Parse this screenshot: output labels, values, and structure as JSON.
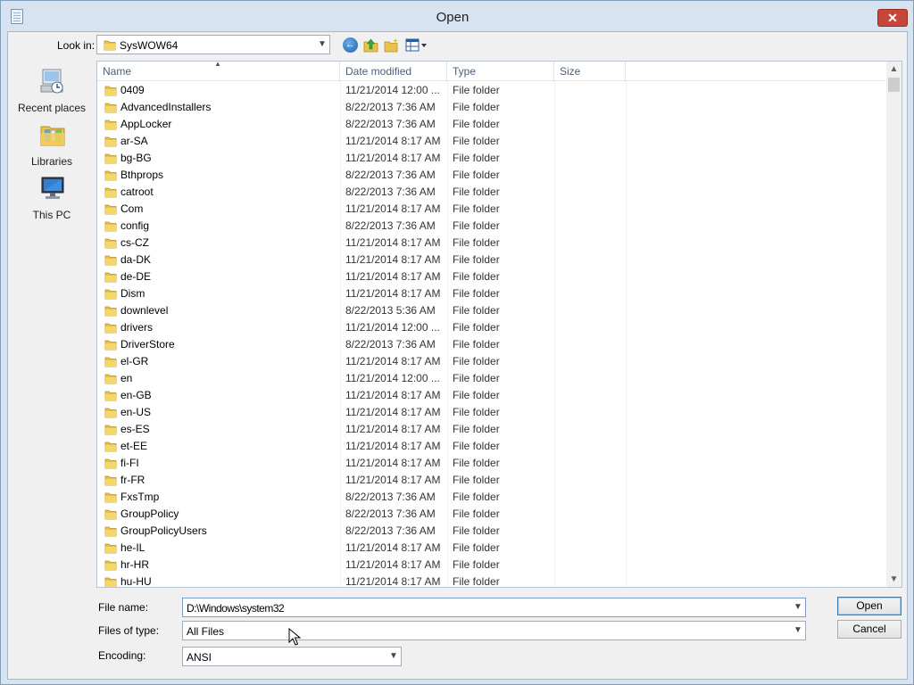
{
  "window": {
    "title": "Open",
    "close_label": "✕"
  },
  "toolbar": {
    "look_in_label": "Look in:",
    "look_in_value": "SysWOW64"
  },
  "places": [
    {
      "label": "Recent places",
      "icon": "recent-places-icon"
    },
    {
      "label": "Libraries",
      "icon": "libraries-icon"
    },
    {
      "label": "This PC",
      "icon": "this-pc-icon"
    }
  ],
  "columns": {
    "name": "Name",
    "date": "Date modified",
    "type": "Type",
    "size": "Size"
  },
  "files": [
    {
      "name": "0409",
      "date": "11/21/2014 12:00 ...",
      "type": "File folder"
    },
    {
      "name": "AdvancedInstallers",
      "date": "8/22/2013 7:36 AM",
      "type": "File folder"
    },
    {
      "name": "AppLocker",
      "date": "8/22/2013 7:36 AM",
      "type": "File folder"
    },
    {
      "name": "ar-SA",
      "date": "11/21/2014 8:17 AM",
      "type": "File folder"
    },
    {
      "name": "bg-BG",
      "date": "11/21/2014 8:17 AM",
      "type": "File folder"
    },
    {
      "name": "Bthprops",
      "date": "8/22/2013 7:36 AM",
      "type": "File folder"
    },
    {
      "name": "catroot",
      "date": "8/22/2013 7:36 AM",
      "type": "File folder"
    },
    {
      "name": "Com",
      "date": "11/21/2014 8:17 AM",
      "type": "File folder"
    },
    {
      "name": "config",
      "date": "8/22/2013 7:36 AM",
      "type": "File folder"
    },
    {
      "name": "cs-CZ",
      "date": "11/21/2014 8:17 AM",
      "type": "File folder"
    },
    {
      "name": "da-DK",
      "date": "11/21/2014 8:17 AM",
      "type": "File folder"
    },
    {
      "name": "de-DE",
      "date": "11/21/2014 8:17 AM",
      "type": "File folder"
    },
    {
      "name": "Dism",
      "date": "11/21/2014 8:17 AM",
      "type": "File folder"
    },
    {
      "name": "downlevel",
      "date": "8/22/2013 5:36 AM",
      "type": "File folder"
    },
    {
      "name": "drivers",
      "date": "11/21/2014 12:00 ...",
      "type": "File folder"
    },
    {
      "name": "DriverStore",
      "date": "8/22/2013 7:36 AM",
      "type": "File folder"
    },
    {
      "name": "el-GR",
      "date": "11/21/2014 8:17 AM",
      "type": "File folder"
    },
    {
      "name": "en",
      "date": "11/21/2014 12:00 ...",
      "type": "File folder"
    },
    {
      "name": "en-GB",
      "date": "11/21/2014 8:17 AM",
      "type": "File folder"
    },
    {
      "name": "en-US",
      "date": "11/21/2014 8:17 AM",
      "type": "File folder"
    },
    {
      "name": "es-ES",
      "date": "11/21/2014 8:17 AM",
      "type": "File folder"
    },
    {
      "name": "et-EE",
      "date": "11/21/2014 8:17 AM",
      "type": "File folder"
    },
    {
      "name": "fi-FI",
      "date": "11/21/2014 8:17 AM",
      "type": "File folder"
    },
    {
      "name": "fr-FR",
      "date": "11/21/2014 8:17 AM",
      "type": "File folder"
    },
    {
      "name": "FxsTmp",
      "date": "8/22/2013 7:36 AM",
      "type": "File folder"
    },
    {
      "name": "GroupPolicy",
      "date": "8/22/2013 7:36 AM",
      "type": "File folder"
    },
    {
      "name": "GroupPolicyUsers",
      "date": "8/22/2013 7:36 AM",
      "type": "File folder"
    },
    {
      "name": "he-IL",
      "date": "11/21/2014 8:17 AM",
      "type": "File folder"
    },
    {
      "name": "hr-HR",
      "date": "11/21/2014 8:17 AM",
      "type": "File folder"
    },
    {
      "name": "hu-HU",
      "date": "11/21/2014 8:17 AM",
      "type": "File folder"
    }
  ],
  "form": {
    "file_name_label": "File name:",
    "file_name_value": "D:\\Windows\\system32",
    "file_type_label": "Files of type:",
    "file_type_value": "All Files",
    "encoding_label": "Encoding:",
    "encoding_value": "ANSI"
  },
  "buttons": {
    "open": "Open",
    "cancel": "Cancel"
  },
  "colors": {
    "folder": "#e8c24a",
    "title_close": "#c7463a",
    "header_text": "#4c607a"
  }
}
